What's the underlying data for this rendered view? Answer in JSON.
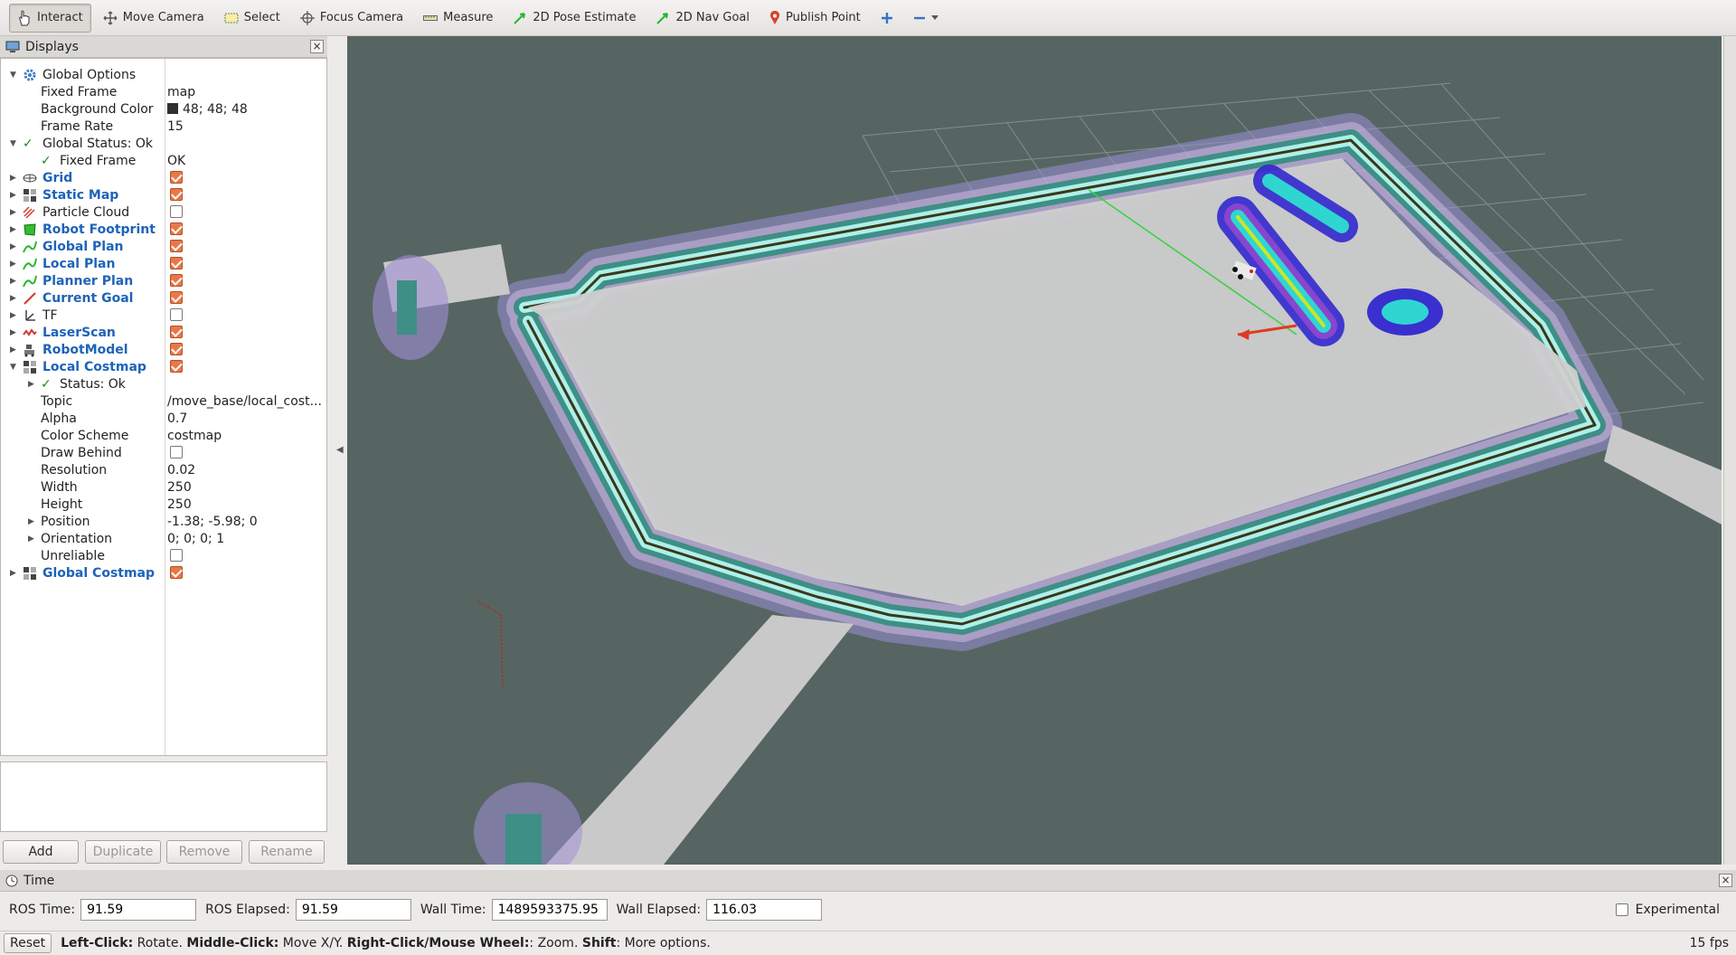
{
  "toolbar": {
    "interact": "Interact",
    "move_camera": "Move Camera",
    "select": "Select",
    "focus_camera": "Focus Camera",
    "measure": "Measure",
    "pose_estimate": "2D Pose Estimate",
    "nav_goal": "2D Nav Goal",
    "publish_point": "Publish Point"
  },
  "displays": {
    "title": "Displays",
    "close": "×",
    "global_options": "Global Options",
    "fixed_frame_label": "Fixed Frame",
    "fixed_frame_value": "map",
    "bg_color_label": "Background Color",
    "bg_color_value": "48; 48; 48",
    "frame_rate_label": "Frame Rate",
    "frame_rate_value": "15",
    "global_status": "Global Status: Ok",
    "fixed_frame_status_label": "Fixed Frame",
    "fixed_frame_status_value": "OK",
    "items": [
      {
        "name": "Grid",
        "checked": true,
        "blue": true
      },
      {
        "name": "Static Map",
        "checked": true,
        "blue": true
      },
      {
        "name": "Particle Cloud",
        "checked": false,
        "blue": false
      },
      {
        "name": "Robot Footprint",
        "checked": true,
        "blue": true
      },
      {
        "name": "Global Plan",
        "checked": true,
        "blue": true
      },
      {
        "name": "Local Plan",
        "checked": true,
        "blue": true
      },
      {
        "name": "Planner Plan",
        "checked": true,
        "blue": true
      },
      {
        "name": "Current Goal",
        "checked": true,
        "blue": true
      },
      {
        "name": "TF",
        "checked": false,
        "blue": false
      },
      {
        "name": "LaserScan",
        "checked": true,
        "blue": true
      },
      {
        "name": "RobotModel",
        "checked": true,
        "blue": true
      },
      {
        "name": "Local Costmap",
        "checked": true,
        "blue": true
      }
    ],
    "local_costmap": {
      "status": "Status: Ok",
      "topic_label": "Topic",
      "topic_value": "/move_base/local_cost...",
      "alpha_label": "Alpha",
      "alpha_value": "0.7",
      "scheme_label": "Color Scheme",
      "scheme_value": "costmap",
      "draw_behind_label": "Draw Behind",
      "resolution_label": "Resolution",
      "resolution_value": "0.02",
      "width_label": "Width",
      "width_value": "250",
      "height_label": "Height",
      "height_value": "250",
      "position_label": "Position",
      "position_value": "-1.38; -5.98; 0",
      "orientation_label": "Orientation",
      "orientation_value": "0; 0; 0; 1",
      "unreliable_label": "Unreliable"
    },
    "global_costmap": "Global Costmap"
  },
  "buttons": {
    "add": "Add",
    "duplicate": "Duplicate",
    "remove": "Remove",
    "rename": "Rename"
  },
  "time": {
    "title": "Time",
    "ros_time_label": "ROS Time:",
    "ros_time_value": "91.59",
    "ros_elapsed_label": "ROS Elapsed:",
    "ros_elapsed_value": "91.59",
    "wall_time_label": "Wall Time:",
    "wall_time_value": "1489593375.95",
    "wall_elapsed_label": "Wall Elapsed:",
    "wall_elapsed_value": "116.03",
    "experimental": "Experimental"
  },
  "status": {
    "reset": "Reset",
    "left_click": "Left-Click:",
    "left_click_desc": " Rotate. ",
    "middle_click": "Middle-Click:",
    "middle_click_desc": " Move X/Y. ",
    "right_click": "Right-Click/Mouse Wheel:",
    "right_click_desc": ": Zoom. ",
    "shift": "Shift",
    "shift_desc": ": More options.",
    "fps": "15 fps"
  }
}
